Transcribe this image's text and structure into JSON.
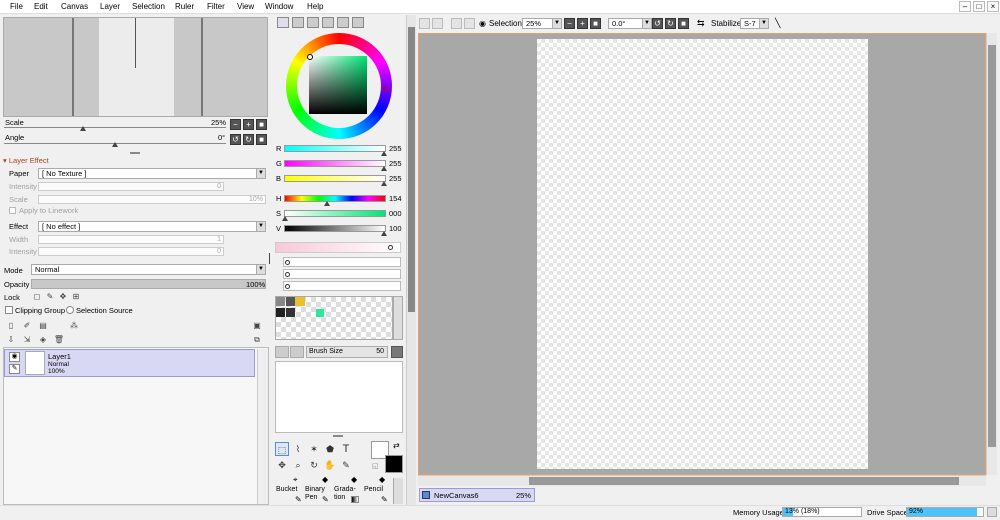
{
  "menu": [
    "File",
    "Edit",
    "Canvas",
    "Layer",
    "Selection",
    "Ruler",
    "Filter",
    "View",
    "Window",
    "Help"
  ],
  "window_buttons": [
    "–",
    "□",
    "×"
  ],
  "navigator": {
    "scale_label": "Scale",
    "scale_value": "25%",
    "angle_label": "Angle",
    "angle_value": "0°",
    "zoom_minus": "−",
    "zoom_plus": "+",
    "zoom_reset": "■",
    "rot_left": "↺",
    "rot_right": "↻",
    "rot_reset": "■"
  },
  "layer_effect": {
    "header": "Layer Effect",
    "paper_label": "Paper",
    "paper_value": "[ No Texture ]",
    "intensity_label": "Intensity",
    "intensity_value": "0",
    "scale_label": "Scale",
    "scale_value": "10%",
    "apply_linework": "Apply to Linework",
    "effect_label": "Effect",
    "effect_value": "[ No effect ]",
    "width_label": "Width",
    "width_value": "1",
    "intensity2_label": "Intensity",
    "intensity2_value": "0"
  },
  "layer_props": {
    "mode_label": "Mode",
    "mode_value": "Normal",
    "opacity_label": "Opacity",
    "opacity_value": "100%",
    "lock_label": "Lock",
    "clipping_group": "Clipping Group",
    "selection_source": "Selection Source"
  },
  "layers": [
    {
      "name": "Layer1",
      "mode": "Normal",
      "opacity": "100%"
    }
  ],
  "color": {
    "r_label": "R",
    "r_value": "255",
    "g_label": "G",
    "g_value": "255",
    "b_label": "B",
    "b_value": "255",
    "h_label": "H",
    "h_value": "154",
    "s_label": "S",
    "s_value": "000",
    "v_label": "V",
    "v_value": "100",
    "primary": "#ffffff",
    "secondary": "#000000"
  },
  "swatches": [
    "#888888",
    "#555555",
    "#e8c030",
    "#dddddd",
    "#222222",
    "#333333",
    "#ffffff",
    "#ffffff",
    "#ffffff",
    "#ffffff",
    "#2ee89a",
    "#ffffff"
  ],
  "brush": {
    "size_label": "Brush Size",
    "size_value": "50"
  },
  "tools": {
    "text_tool": "T",
    "bucket": "Bucket",
    "binary_pen": "Binary Pen",
    "gradation": "Grada-tion",
    "pencil": "Pencil"
  },
  "toolbar": {
    "selection_label": "Selection",
    "zoom_value": "25%",
    "angle_value": "0.0°",
    "stabilizer_label": "Stabilizer",
    "stabilizer_value": "S-7"
  },
  "canvas_tab": {
    "name": "NewCanvas6",
    "zoom": "25%"
  },
  "status": {
    "memory_label": "Memory Usage",
    "memory_value": "13% (18%)",
    "memory_fraction": 0.13,
    "drive_label": "Drive Space",
    "drive_value": "92%",
    "drive_fraction": 0.92,
    "meter_color": "#4fc3f7"
  }
}
